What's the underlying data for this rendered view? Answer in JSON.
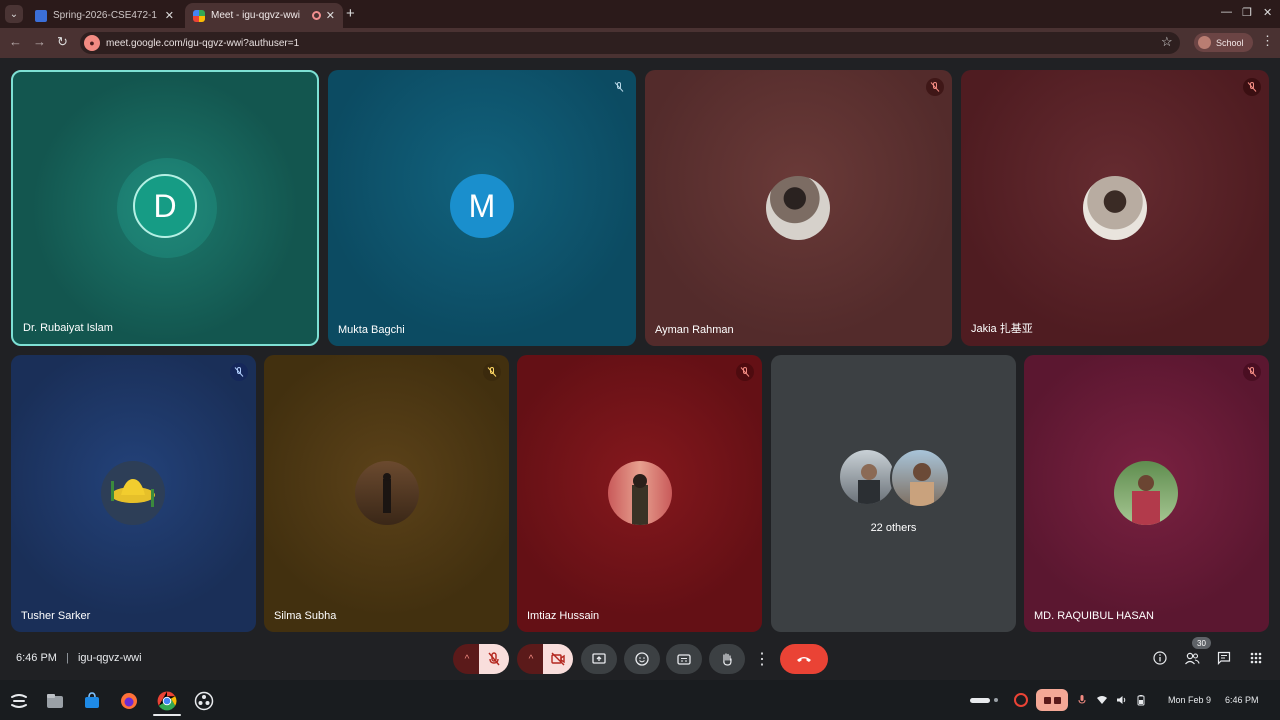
{
  "browser": {
    "tabs": [
      {
        "title": "Spring-2026-CSE472-1 SE",
        "active": false
      },
      {
        "title": "Meet - igu-qgvz-wwi",
        "active": true
      }
    ],
    "url": "meet.google.com/igu-qgvz-wwi?authuser=1",
    "profile_label": "School"
  },
  "meeting": {
    "time": "6:46 PM",
    "separator": "|",
    "code": "igu-qgvz-wwi",
    "participant_count": "30",
    "participants": [
      {
        "name": "Dr. Rubaiyat Islam",
        "initial": "D",
        "color": "#13564f",
        "avatar": "letter",
        "avatar_color": "#169c85"
      },
      {
        "name": "Mukta Bagchi",
        "initial": "M",
        "color": "#0c5068",
        "avatar": "letter",
        "avatar_color": "#1a8fcd"
      },
      {
        "name": "Ayman Rahman",
        "color": "#5a2f2f",
        "avatar": "photo"
      },
      {
        "name": "Jakia 扎基亚",
        "color": "#571f25",
        "avatar": "photo"
      },
      {
        "name": "Tusher Sarker",
        "color": "#1d3563",
        "avatar": "photo"
      },
      {
        "name": "Silma Subha",
        "color": "#4a3515",
        "avatar": "photo"
      },
      {
        "name": "Imtiaz Hussain",
        "color": "#6c1419",
        "avatar": "photo"
      },
      {
        "name": "MD. RAQUIBUL HASAN",
        "color": "#5e1c33",
        "avatar": "photo"
      }
    ],
    "others_label": "22 others"
  },
  "shelf": {
    "date": "Mon Feb 9",
    "time": "6:46 PM"
  }
}
